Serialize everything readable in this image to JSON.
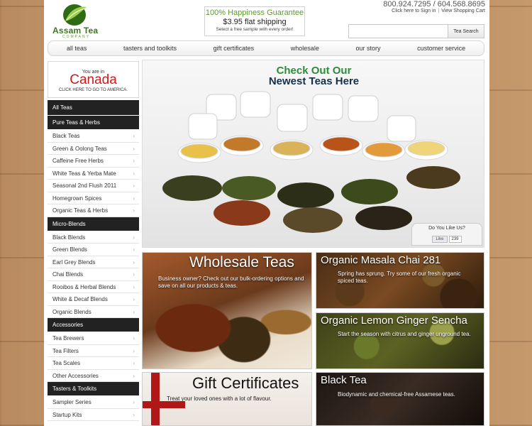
{
  "header": {
    "logo_text": "Assam Tea",
    "logo_sub": "COMPANY",
    "guarantee_title": "100% Happiness Guarantee",
    "guarantee_shipping": "$3.95 flat shipping",
    "guarantee_note": "Select a free sample with every order!",
    "phone": "800.924.7295 / 604.568.8695",
    "sign_in": "Click here to Sign in",
    "cart": "View Shopping Cart",
    "search_button": "Tea Search"
  },
  "nav": {
    "items": [
      "all teas",
      "tasters and toolkits",
      "gift certificates",
      "wholesale",
      "our story",
      "customer service"
    ]
  },
  "country": {
    "prefix": "You are in",
    "name": "Canada",
    "switch": "CLICK HERE TO GO TO AMERICA."
  },
  "sidebar": {
    "all_teas": "All Teas",
    "sections": [
      {
        "title": "Pure Teas & Herbs",
        "items": [
          "Black Teas",
          "Green & Oolong Teas",
          "Caffeine Free Herbs",
          "White Teas & Yerba Mate",
          "Seasonal 2nd Flush 2011",
          "Homegrown Spices",
          "Organic Teas & Herbs"
        ]
      },
      {
        "title": "Micro-Blends",
        "items": [
          "Black Blends",
          "Green Blends",
          "Earl Grey Blends",
          "Chai Blends",
          "Rooibos & Herbal Blends",
          "White & Decaf Blends",
          "Organic Blends"
        ]
      },
      {
        "title": "Accessories",
        "items": [
          "Tea Brewers",
          "Tea Filters",
          "Tea Scales",
          "Other Accessories"
        ]
      },
      {
        "title": "Tasters & Toolkits",
        "items": [
          "Sampler Series",
          "Startup Kits"
        ]
      }
    ]
  },
  "hero": {
    "line1": "Check Out Our",
    "line2": "Newest Teas Here",
    "like_question": "Do You Like Us?",
    "like_button": "Like",
    "like_count": "239"
  },
  "tiles": {
    "wholesale": {
      "title": "Wholesale Teas",
      "desc": "Business owner? Check out our bulk-ordering options and save on all our products & teas."
    },
    "chai": {
      "title": "Organic Masala Chai 281",
      "desc": "Spring has sprung. Try some of our fresh organic spiced teas."
    },
    "ginger": {
      "title": "Organic Lemon Ginger Sencha",
      "desc": "Start the season with citrus and ginger unground tea."
    },
    "gift": {
      "title": "Gift Certificates",
      "desc": "Treat your loved ones with a lot of flavour."
    },
    "black": {
      "title": "Black Tea",
      "desc": "Biodynamic and chemical-free Assamese teas."
    }
  },
  "colors": {
    "brand_green": "#3b7a1c",
    "canada_red": "#d11a1a",
    "sidebar_dark": "#222222"
  }
}
